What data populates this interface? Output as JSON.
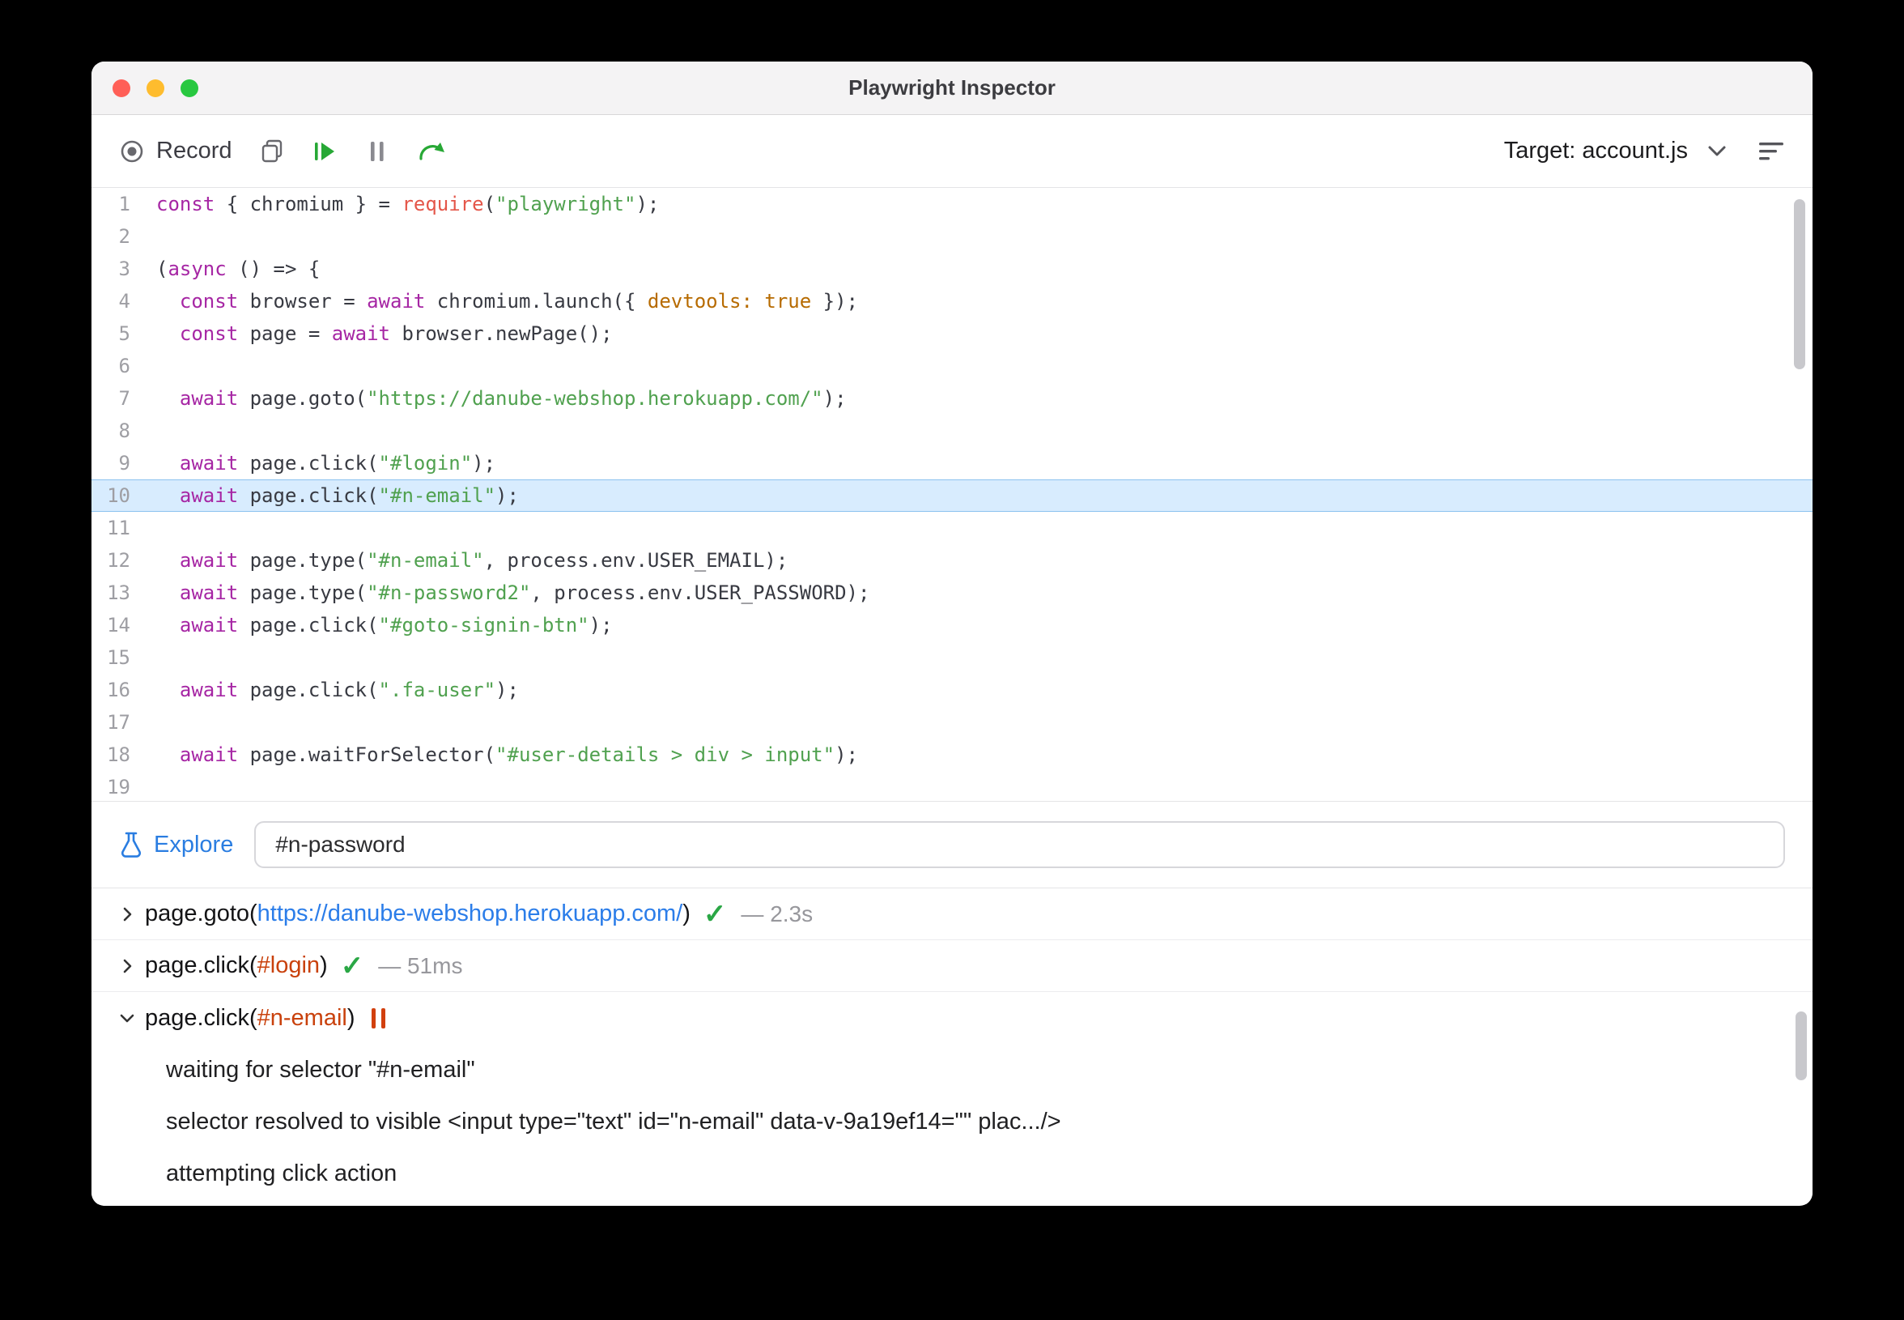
{
  "titlebar": {
    "title": "Playwright Inspector"
  },
  "toolbar": {
    "record_label": "Record",
    "target_label": "Target: account.js"
  },
  "icons": {
    "record-icon": "circle-with-dot",
    "copy-icon": "overlapping-squares",
    "resume-icon": "bar-plus-play-triangle",
    "pause-icon": "double-vertical-bars",
    "step-over-icon": "curved-arrow",
    "chevron-down-icon": "v-chevron",
    "log-lines-icon": "three-horizontal-lines",
    "explore-flask-icon": "flask",
    "success-check-icon": "✓",
    "paused-icon": "double-vertical-bars-orange",
    "chevron-right-icon": "right-chevron"
  },
  "colors": {
    "keyword_purple": "#a626a4",
    "string_green": "#50a14f",
    "function_red": "#e45649",
    "atom_orange": "#b76b01",
    "accent_green": "#27a835",
    "link_blue": "#2b7de9",
    "selector_orange": "#c9410c",
    "check_green": "#2aa745",
    "highlight_blue": "#d8ecfe",
    "traffic_red": "#ff5f57",
    "traffic_yellow": "#febc2e",
    "traffic_green": "#28c840"
  },
  "editor": {
    "highlighted_line": 10,
    "lines": [
      {
        "n": 1,
        "seg": [
          [
            "k",
            "const"
          ],
          [
            "p",
            " { chromium } = "
          ],
          [
            "f",
            "require"
          ],
          [
            "p",
            "("
          ],
          [
            "s",
            "\"playwright\""
          ],
          [
            "p",
            ");"
          ]
        ]
      },
      {
        "n": 2,
        "seg": []
      },
      {
        "n": 3,
        "seg": [
          [
            "p",
            "("
          ],
          [
            "k",
            "async"
          ],
          [
            "p",
            " () => {"
          ]
        ]
      },
      {
        "n": 4,
        "seg": [
          [
            "p",
            "  "
          ],
          [
            "k",
            "const"
          ],
          [
            "p",
            " browser = "
          ],
          [
            "k",
            "await"
          ],
          [
            "p",
            " chromium.launch({ "
          ],
          [
            "a",
            "devtools:"
          ],
          [
            "p",
            " "
          ],
          [
            "a",
            "true"
          ],
          [
            "p",
            " });"
          ]
        ]
      },
      {
        "n": 5,
        "seg": [
          [
            "p",
            "  "
          ],
          [
            "k",
            "const"
          ],
          [
            "p",
            " page = "
          ],
          [
            "k",
            "await"
          ],
          [
            "p",
            " browser.newPage();"
          ]
        ]
      },
      {
        "n": 6,
        "seg": []
      },
      {
        "n": 7,
        "seg": [
          [
            "p",
            "  "
          ],
          [
            "k",
            "await"
          ],
          [
            "p",
            " page.goto("
          ],
          [
            "s",
            "\"https://danube-webshop.herokuapp.com/\""
          ],
          [
            "p",
            ");"
          ]
        ]
      },
      {
        "n": 8,
        "seg": []
      },
      {
        "n": 9,
        "seg": [
          [
            "p",
            "  "
          ],
          [
            "k",
            "await"
          ],
          [
            "p",
            " page.click("
          ],
          [
            "s",
            "\"#login\""
          ],
          [
            "p",
            ");"
          ]
        ]
      },
      {
        "n": 10,
        "seg": [
          [
            "p",
            "  "
          ],
          [
            "k",
            "await"
          ],
          [
            "p",
            " page.click("
          ],
          [
            "s",
            "\"#n-email\""
          ],
          [
            "p",
            ");"
          ]
        ]
      },
      {
        "n": 11,
        "seg": []
      },
      {
        "n": 12,
        "seg": [
          [
            "p",
            "  "
          ],
          [
            "k",
            "await"
          ],
          [
            "p",
            " page.type("
          ],
          [
            "s",
            "\"#n-email\""
          ],
          [
            "p",
            ", process.env.USER_EMAIL);"
          ]
        ]
      },
      {
        "n": 13,
        "seg": [
          [
            "p",
            "  "
          ],
          [
            "k",
            "await"
          ],
          [
            "p",
            " page.type("
          ],
          [
            "s",
            "\"#n-password2\""
          ],
          [
            "p",
            ", process.env.USER_PASSWORD);"
          ]
        ]
      },
      {
        "n": 14,
        "seg": [
          [
            "p",
            "  "
          ],
          [
            "k",
            "await"
          ],
          [
            "p",
            " page.click("
          ],
          [
            "s",
            "\"#goto-signin-btn\""
          ],
          [
            "p",
            ");"
          ]
        ]
      },
      {
        "n": 15,
        "seg": []
      },
      {
        "n": 16,
        "seg": [
          [
            "p",
            "  "
          ],
          [
            "k",
            "await"
          ],
          [
            "p",
            " page.click("
          ],
          [
            "s",
            "\".fa-user\""
          ],
          [
            "p",
            ");"
          ]
        ]
      },
      {
        "n": 17,
        "seg": []
      },
      {
        "n": 18,
        "seg": [
          [
            "p",
            "  "
          ],
          [
            "k",
            "await"
          ],
          [
            "p",
            " page.waitForSelector("
          ],
          [
            "s",
            "\"#user-details > div > input\""
          ],
          [
            "p",
            ");"
          ]
        ]
      },
      {
        "n": 19,
        "seg": []
      }
    ]
  },
  "explore": {
    "label": "Explore",
    "input_value": "#n-password"
  },
  "log": {
    "entries": [
      {
        "expanded": false,
        "method": "page.goto(",
        "arg": "https://danube-webshop.herokuapp.com/",
        "arg_style": "link",
        "suffix": ")",
        "status": "success",
        "duration": "— 2.3s",
        "details": []
      },
      {
        "expanded": false,
        "method": "page.click(",
        "arg": "#login",
        "arg_style": "selector",
        "suffix": ")",
        "status": "success",
        "duration": "— 51ms",
        "details": []
      },
      {
        "expanded": true,
        "method": "page.click(",
        "arg": "#n-email",
        "arg_style": "selector",
        "suffix": ")",
        "status": "paused",
        "duration": "",
        "details": [
          "waiting for selector \"#n-email\"",
          "selector resolved to visible <input type=\"text\" id=\"n-email\" data-v-9a19ef14=\"\" plac.../>",
          "attempting click action"
        ]
      }
    ]
  }
}
